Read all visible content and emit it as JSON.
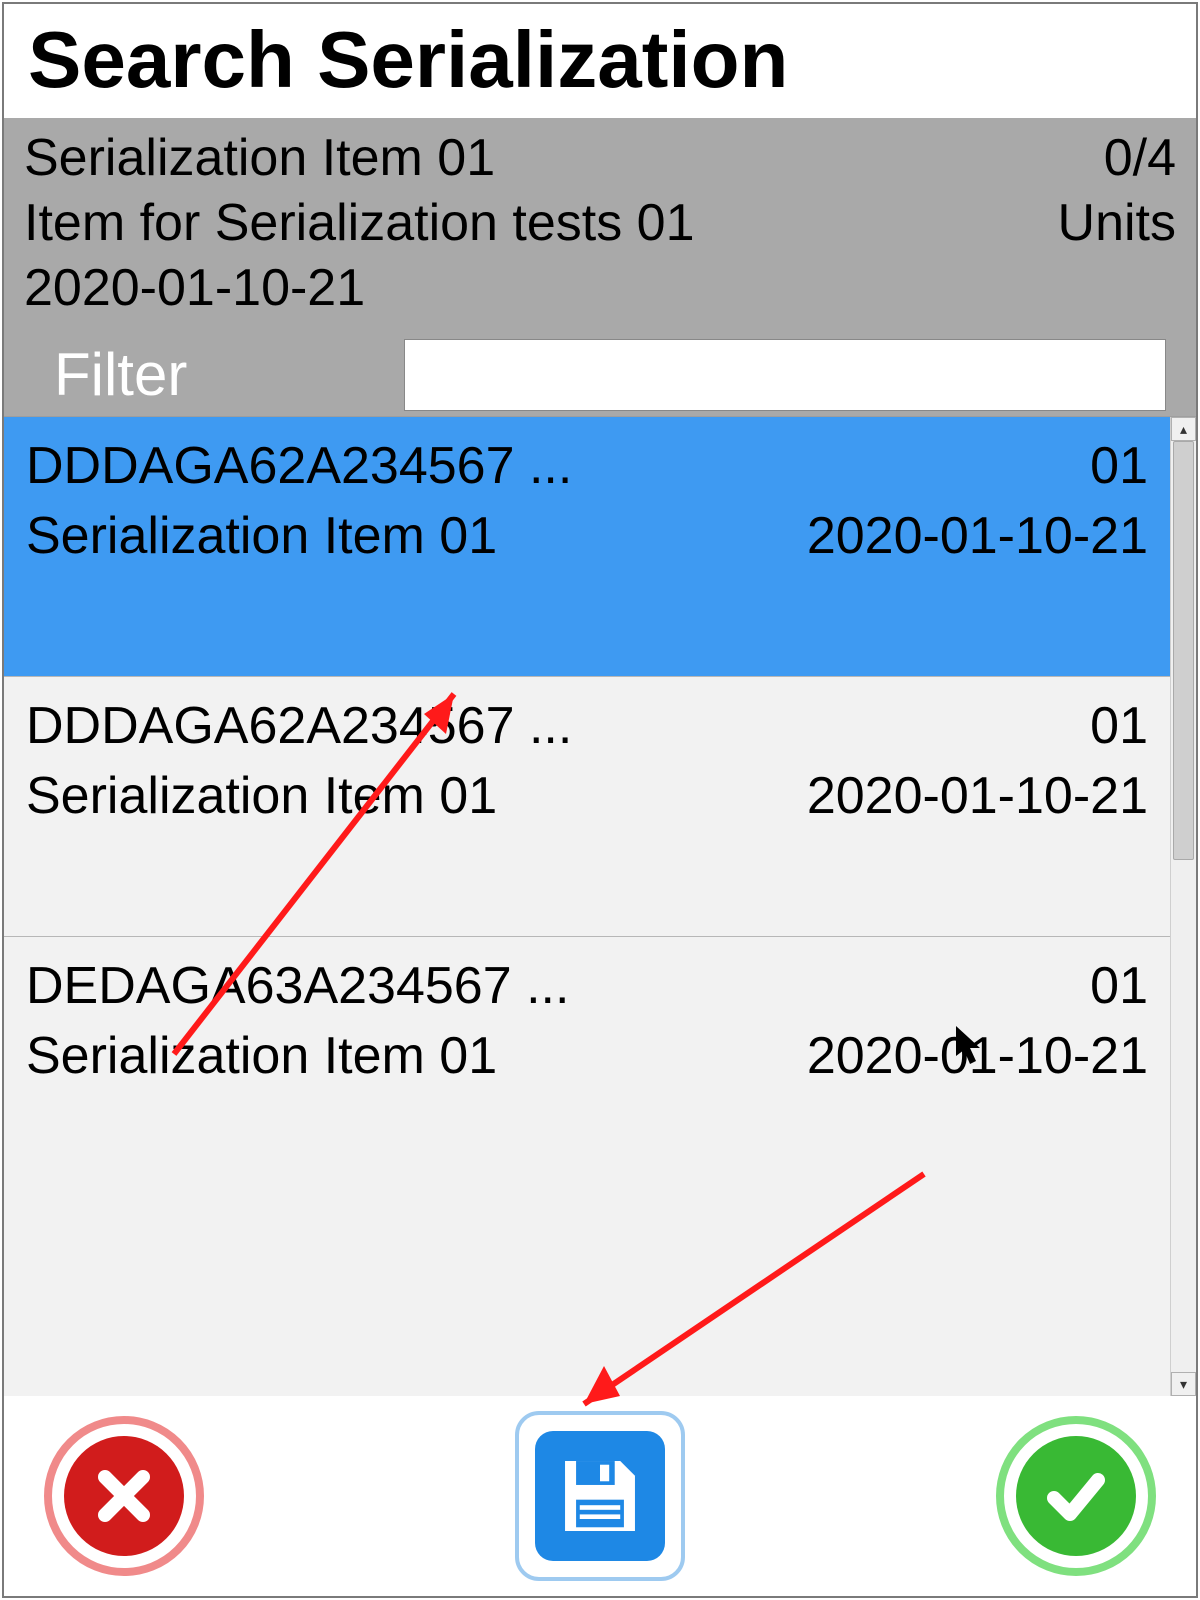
{
  "title": "Search Serialization",
  "header": {
    "item_name": "Serialization Item 01",
    "count": "0/4",
    "description": "Item for Serialization tests 01",
    "units_label": "Units",
    "batch": "2020-01-10-21",
    "filter_label": "Filter",
    "filter_value": ""
  },
  "rows": [
    {
      "serial": "DDDAGA62A234567 ...",
      "code": "01",
      "item": "Serialization Item 01",
      "date": "2020-01-10-21",
      "selected": true
    },
    {
      "serial": "DDDAGA62A234567 ...",
      "code": "01",
      "item": "Serialization Item 01",
      "date": "2020-01-10-21",
      "selected": false
    },
    {
      "serial": "DEDAGA63A234567 ...",
      "code": "01",
      "item": "Serialization Item 01",
      "date": "2020-01-10-21",
      "selected": false
    }
  ],
  "footer": {
    "cancel_label": "Cancel",
    "save_label": "Save",
    "confirm_label": "Confirm"
  },
  "colors": {
    "selected_row": "#3e9af2",
    "cancel": "#d11c1c",
    "save": "#1e88e5",
    "confirm": "#39b934",
    "annotation": "#ff1a1a"
  }
}
